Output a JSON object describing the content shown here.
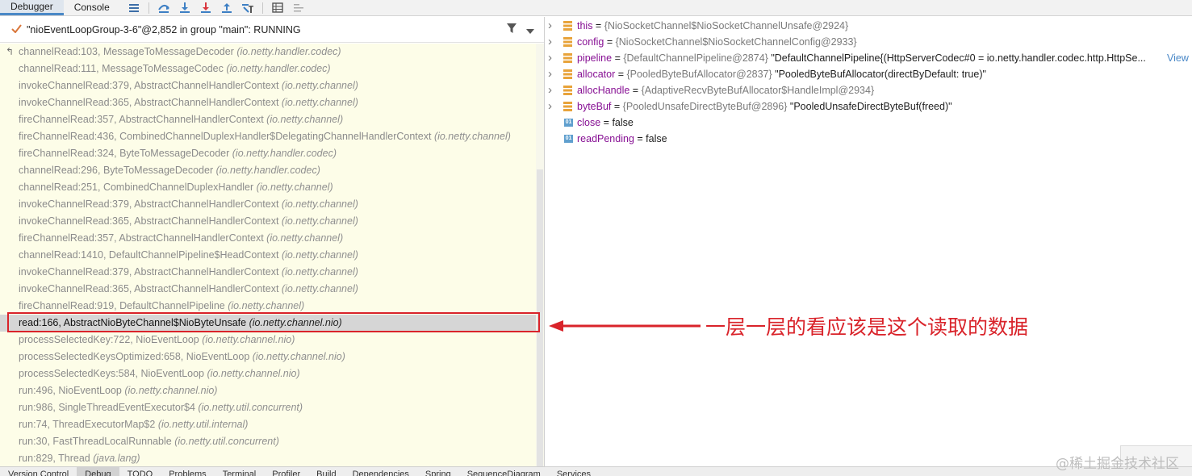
{
  "tabs": [
    {
      "label": "Debugger",
      "active": true
    },
    {
      "label": "Console",
      "active": false
    }
  ],
  "toolbar_icons": [
    "list-icon",
    "step-over-icon",
    "step-into-icon",
    "force-step-into-icon",
    "step-out-icon",
    "run-to-cursor-icon",
    "evaluate-icon",
    "trace-icon"
  ],
  "thread": {
    "label": "\"nioEventLoopGroup-3-6\"@2,852 in group \"main\": RUNNING"
  },
  "frames": [
    {
      "method": "channelRead:103, MessageToMessageDecoder",
      "pkg": "(io.netty.handler.codec)"
    },
    {
      "method": "channelRead:111, MessageToMessageCodec",
      "pkg": "(io.netty.handler.codec)"
    },
    {
      "method": "invokeChannelRead:379, AbstractChannelHandlerContext",
      "pkg": "(io.netty.channel)"
    },
    {
      "method": "invokeChannelRead:365, AbstractChannelHandlerContext",
      "pkg": "(io.netty.channel)"
    },
    {
      "method": "fireChannelRead:357, AbstractChannelHandlerContext",
      "pkg": "(io.netty.channel)"
    },
    {
      "method": "fireChannelRead:436, CombinedChannelDuplexHandler$DelegatingChannelHandlerContext",
      "pkg": "(io.netty.channel)"
    },
    {
      "method": "fireChannelRead:324, ByteToMessageDecoder",
      "pkg": "(io.netty.handler.codec)"
    },
    {
      "method": "channelRead:296, ByteToMessageDecoder",
      "pkg": "(io.netty.handler.codec)"
    },
    {
      "method": "channelRead:251, CombinedChannelDuplexHandler",
      "pkg": "(io.netty.channel)"
    },
    {
      "method": "invokeChannelRead:379, AbstractChannelHandlerContext",
      "pkg": "(io.netty.channel)"
    },
    {
      "method": "invokeChannelRead:365, AbstractChannelHandlerContext",
      "pkg": "(io.netty.channel)"
    },
    {
      "method": "fireChannelRead:357, AbstractChannelHandlerContext",
      "pkg": "(io.netty.channel)"
    },
    {
      "method": "channelRead:1410, DefaultChannelPipeline$HeadContext",
      "pkg": "(io.netty.channel)"
    },
    {
      "method": "invokeChannelRead:379, AbstractChannelHandlerContext",
      "pkg": "(io.netty.channel)"
    },
    {
      "method": "invokeChannelRead:365, AbstractChannelHandlerContext",
      "pkg": "(io.netty.channel)"
    },
    {
      "method": "fireChannelRead:919, DefaultChannelPipeline",
      "pkg": "(io.netty.channel)"
    },
    {
      "method": "read:166, AbstractNioByteChannel$NioByteUnsafe",
      "pkg": "(io.netty.channel.nio)",
      "selected": true
    },
    {
      "method": "processSelectedKey:722, NioEventLoop",
      "pkg": "(io.netty.channel.nio)"
    },
    {
      "method": "processSelectedKeysOptimized:658, NioEventLoop",
      "pkg": "(io.netty.channel.nio)"
    },
    {
      "method": "processSelectedKeys:584, NioEventLoop",
      "pkg": "(io.netty.channel.nio)"
    },
    {
      "method": "run:496, NioEventLoop",
      "pkg": "(io.netty.channel.nio)"
    },
    {
      "method": "run:986, SingleThreadEventExecutor$4",
      "pkg": "(io.netty.util.concurrent)"
    },
    {
      "method": "run:74, ThreadExecutorMap$2",
      "pkg": "(io.netty.util.internal)"
    },
    {
      "method": "run:30, FastThreadLocalRunnable",
      "pkg": "(io.netty.util.concurrent)"
    },
    {
      "method": "run:829, Thread",
      "pkg": "(java.lang)"
    }
  ],
  "variables": [
    {
      "name": "this",
      "eq": " = ",
      "ref": "{NioSocketChannel$NioSocketChannelUnsafe@2924}",
      "str": "",
      "expandable": true,
      "kind": "field"
    },
    {
      "name": "config",
      "eq": " = ",
      "ref": "{NioSocketChannel$NioSocketChannelConfig@2933}",
      "str": "",
      "expandable": true,
      "kind": "field"
    },
    {
      "name": "pipeline",
      "eq": " = ",
      "ref": "{DefaultChannelPipeline@2874}",
      "str": " \"DefaultChannelPipeline{(HttpServerCodec#0 = io.netty.handler.codec.http.HttpSe...",
      "expandable": true,
      "kind": "field",
      "link": "View"
    },
    {
      "name": "allocator",
      "eq": " = ",
      "ref": "{PooledByteBufAllocator@2837}",
      "str": " \"PooledByteBufAllocator(directByDefault: true)\"",
      "expandable": true,
      "kind": "field"
    },
    {
      "name": "allocHandle",
      "eq": " = ",
      "ref": "{AdaptiveRecvByteBufAllocator$HandleImpl@2934}",
      "str": "",
      "expandable": true,
      "kind": "field"
    },
    {
      "name": "byteBuf",
      "eq": " = ",
      "ref": "{PooledUnsafeDirectByteBuf@2896}",
      "str": " \"PooledUnsafeDirectByteBuf(freed)\"",
      "expandable": true,
      "kind": "field"
    },
    {
      "name": "close",
      "eq": " = ",
      "ref": "",
      "str": "false",
      "expandable": false,
      "kind": "bool"
    },
    {
      "name": "readPending",
      "eq": " = ",
      "ref": "",
      "str": "false",
      "expandable": false,
      "kind": "bool"
    }
  ],
  "bool_icon_text": "01",
  "annotation": {
    "text": "一层一层的看应该是这个读取的数据",
    "color": "#d9232a"
  },
  "bottom_tabs": [
    "Version Control",
    "Debug",
    "TODO",
    "Problems",
    "Terminal",
    "Profiler",
    "Build",
    "Dependencies",
    "Spring",
    "SequenceDiagram",
    "Services"
  ],
  "bottom_active": "Debug",
  "watermark": "@稀土掘金技术社区",
  "colors": {
    "accent": "#4a88c7",
    "selection": "#d6d6d6",
    "frames_bg": "#fdfde8",
    "annotation": "#d9232a"
  }
}
